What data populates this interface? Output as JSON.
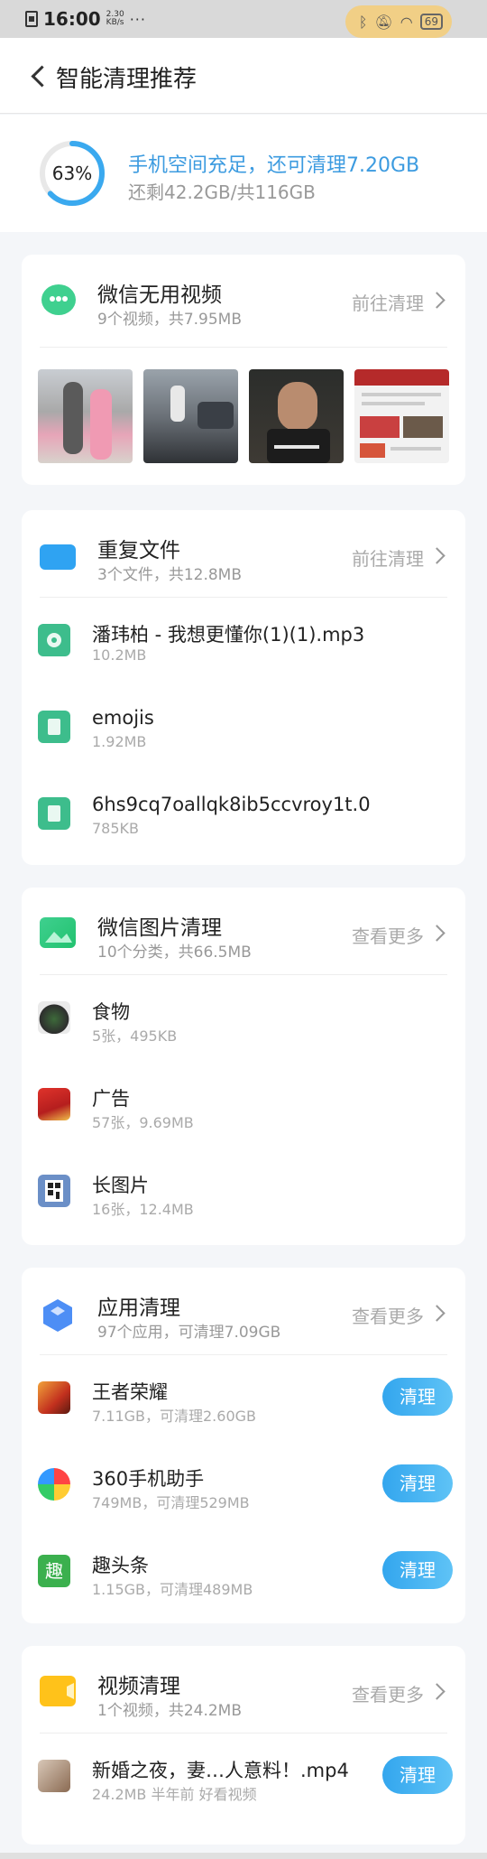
{
  "status_bar": {
    "time": "16:00",
    "net_speed_value": "2.30",
    "net_speed_unit": "KB/s",
    "more": "···",
    "battery": "69",
    "icons": [
      "sim-icon",
      "bluetooth-icon",
      "mute-icon",
      "wifi-icon",
      "battery-icon"
    ]
  },
  "header": {
    "title": "智能清理推荐"
  },
  "summary": {
    "percent": "63%",
    "percent_value": 63,
    "headline": "手机空间充足，还可清理7.20GB",
    "detail": "还剩42.2GB/共116GB"
  },
  "wechat_video": {
    "title": "微信无用视频",
    "subtitle": "9个视频，共7.95MB",
    "action": "前往清理"
  },
  "duplicates": {
    "title": "重复文件",
    "subtitle": "3个文件，共12.8MB",
    "action": "前往清理",
    "items": [
      {
        "name": "潘玮柏 - 我想更懂你(1)(1).mp3",
        "size": "10.2MB",
        "icon": "music-file-icon"
      },
      {
        "name": "emojis",
        "size": "1.92MB",
        "icon": "document-file-icon"
      },
      {
        "name": "6hs9cq7oallqk8ib5ccvroy1t.0",
        "size": "785KB",
        "icon": "document-file-icon"
      }
    ]
  },
  "wechat_images": {
    "title": "微信图片清理",
    "subtitle": "10个分类，共66.5MB",
    "action": "查看更多",
    "items": [
      {
        "name": "食物",
        "detail": "5张，495KB"
      },
      {
        "name": "广告",
        "detail": "57张，9.69MB"
      },
      {
        "name": "长图片",
        "detail": "16张，12.4MB"
      }
    ]
  },
  "apps": {
    "title": "应用清理",
    "subtitle": "97个应用，可清理7.09GB",
    "action": "查看更多",
    "button": "清理",
    "items": [
      {
        "name": "王者荣耀",
        "detail": "7.11GB，可清理2.60GB"
      },
      {
        "name": "360手机助手",
        "detail": "749MB，可清理529MB"
      },
      {
        "name": "趣头条",
        "detail": "1.15GB，可清理489MB",
        "icon_text": "趣"
      }
    ]
  },
  "videos": {
    "title": "视频清理",
    "subtitle": "1个视频，共24.2MB",
    "action": "查看更多",
    "button": "清理",
    "items": [
      {
        "name": "新婚之夜，妻…人意料！.mp4",
        "detail": "24.2MB 半年前 好看视频"
      }
    ]
  },
  "colors": {
    "accent": "#3c9be0",
    "button": "#3aa9ef",
    "file_green": "#3dbd8c",
    "folder_blue": "#2fa3f2",
    "video_yellow": "#ffc21a"
  }
}
